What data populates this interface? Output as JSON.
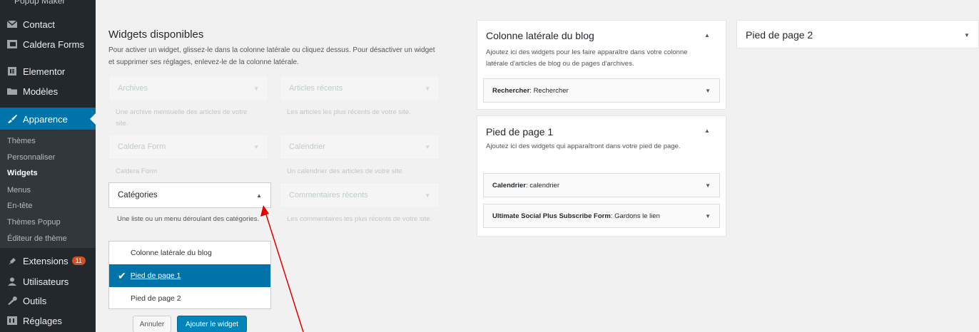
{
  "sidebar": {
    "peek": {
      "label": "Popup Maker",
      "badge": ""
    },
    "items": [
      {
        "label": "Contact",
        "icon": "mail-icon"
      },
      {
        "label": "Caldera Forms",
        "icon": "caldera-icon"
      },
      {
        "label": "Elementor",
        "icon": "elementor-icon"
      },
      {
        "label": "Modèles",
        "icon": "folder-icon"
      },
      {
        "label": "Apparence",
        "icon": "brush-icon"
      },
      {
        "label": "Extensions",
        "icon": "plugin-icon",
        "badge": "11"
      },
      {
        "label": "Utilisateurs",
        "icon": "user-icon"
      },
      {
        "label": "Outils",
        "icon": "wrench-icon"
      },
      {
        "label": "Réglages",
        "icon": "settings-icon"
      }
    ],
    "submenu": [
      "Thèmes",
      "Personnaliser",
      "Widgets",
      "Menus",
      "En-tête",
      "Thèmes Popup",
      "Éditeur de thème"
    ]
  },
  "widgets": {
    "title": "Widgets disponibles",
    "description": "Pour activer un widget, glissez-le dans la colonne latérale ou cliquez dessus. Pour désactiver un widget et supprimer ses réglages, enlevez-le de la colonne latérale.",
    "available": [
      {
        "name": "Archives",
        "desc": "Une archive mensuelle des articles de votre site."
      },
      {
        "name": "Articles récents",
        "desc": "Les articles les plus récents de votre site."
      },
      {
        "name": "Caldera Form",
        "desc": "Caldera Form"
      },
      {
        "name": "Calendrier",
        "desc": "Un calendrier des articles de votre site."
      },
      {
        "name": "Commentaires récents",
        "desc": "Les commentaires les plus récents de votre site."
      }
    ],
    "open": {
      "name": "Catégories",
      "desc": "Une liste ou un menu déroulant des catégories.",
      "options": [
        "Colonne latérale du blog",
        "Pied de page 1",
        "Pied de page 2"
      ],
      "selected": "Pied de page 1",
      "cancel_label": "Annuler",
      "add_label": "Ajouter le widget"
    }
  },
  "areas": {
    "blog": {
      "title": "Colonne latérale du blog",
      "desc": "Ajoutez ici des widgets pour les faire apparaître dans votre colonne latérale d'articles de blog ou de pages d'archives.",
      "widgets": [
        {
          "type": "Rechercher",
          "title": "Rechercher"
        }
      ]
    },
    "footer1": {
      "title": "Pied de page 1",
      "desc": "Ajoutez ici des widgets qui apparaîtront dans votre pied de page.",
      "widgets": [
        {
          "type": "Calendrier",
          "title": "calendrier"
        },
        {
          "type": "Ultimate Social Plus Subscribe Form",
          "title": "Gardons le lien"
        }
      ]
    },
    "footer2": {
      "title": "Pied de page 2"
    }
  },
  "colors": {
    "accent": "#0073aa",
    "sidebar_bg": "#23282d",
    "annotation_arrow": "#e00000"
  }
}
